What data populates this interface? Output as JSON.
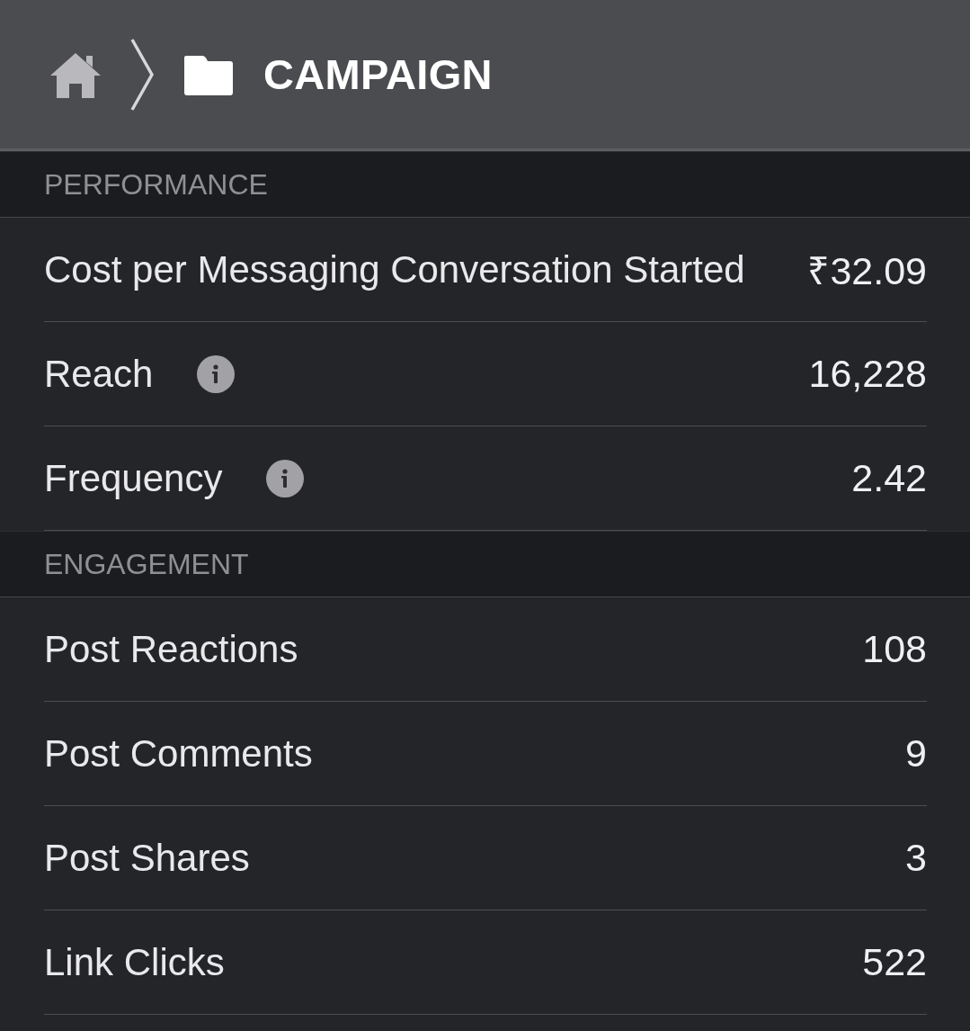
{
  "breadcrumb": {
    "title": "CAMPAIGN"
  },
  "sections": [
    {
      "heading": "PERFORMANCE",
      "rows": [
        {
          "label": "Cost per Messaging Conversation Started",
          "value": "₹32.09",
          "info": false
        },
        {
          "label": "Reach",
          "value": "16,228",
          "info": true
        },
        {
          "label": "Frequency",
          "value": "2.42",
          "info": true
        }
      ]
    },
    {
      "heading": "ENGAGEMENT",
      "rows": [
        {
          "label": "Post Reactions",
          "value": "108",
          "info": false
        },
        {
          "label": "Post Comments",
          "value": "9",
          "info": false
        },
        {
          "label": "Post Shares",
          "value": "3",
          "info": false
        },
        {
          "label": "Link Clicks",
          "value": "522",
          "info": false
        }
      ]
    }
  ]
}
